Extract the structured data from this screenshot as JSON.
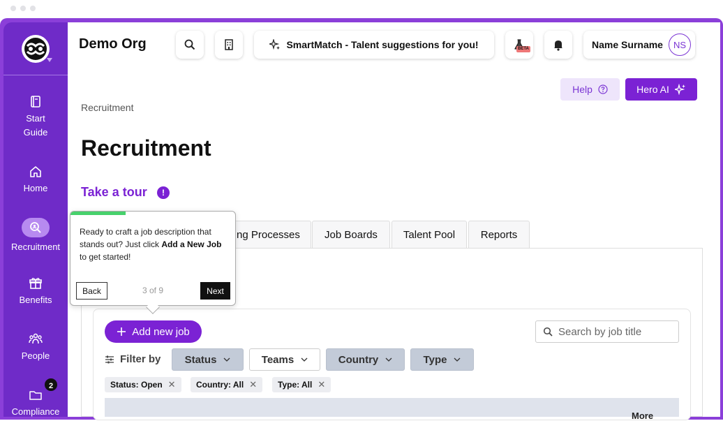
{
  "org": {
    "name": "Demo Org"
  },
  "sidebar": {
    "items": [
      {
        "label": "Start\nGuide",
        "icon": "book-icon"
      },
      {
        "label": "Home",
        "icon": "home-icon"
      },
      {
        "label": "Recruitment",
        "icon": "recruitment-search-icon",
        "active": true
      },
      {
        "label": "Benefits",
        "icon": "gift-icon"
      },
      {
        "label": "People",
        "icon": "people-icon"
      },
      {
        "label": "Compliance",
        "icon": "folder-icon",
        "badge": "2"
      }
    ]
  },
  "header": {
    "smartmatch_label": "SmartMatch - Talent suggestions for you!",
    "beta_label": "BETA",
    "user_name": "Name Surname",
    "user_initials": "NS"
  },
  "actions": {
    "help_label": "Help",
    "hero_label": "Hero AI"
  },
  "breadcrumb": "Recruitment",
  "page_title": "Recruitment",
  "tour": {
    "label": "Take a tour",
    "badge": "!"
  },
  "tabs": [
    {
      "label": "ng Processes"
    },
    {
      "label": "Job Boards"
    },
    {
      "label": "Talent Pool"
    },
    {
      "label": "Reports"
    }
  ],
  "jobs": {
    "add_label": "Add new job",
    "search_placeholder": "Search by job title",
    "filter_label": "Filter by",
    "filters": [
      {
        "label": "Status",
        "style": "filled"
      },
      {
        "label": "Teams",
        "style": "outline"
      },
      {
        "label": "Country",
        "style": "filled"
      },
      {
        "label": "Type",
        "style": "filled"
      }
    ],
    "chips": [
      {
        "label": "Status: Open"
      },
      {
        "label": "Country: All"
      },
      {
        "label": "Type: All"
      }
    ],
    "table_more": "More"
  },
  "tooltip": {
    "text_before": "Ready to craft a job description that stands out? Just click ",
    "text_bold": "Add a New Job",
    "text_after": " to get started!",
    "back_label": "Back",
    "step": "3 of 9",
    "next_label": "Next",
    "progress": 0.333
  },
  "colors": {
    "brand": "#7b22d4",
    "sidebar": "#6f2bc8",
    "progress": "#47d16c"
  }
}
